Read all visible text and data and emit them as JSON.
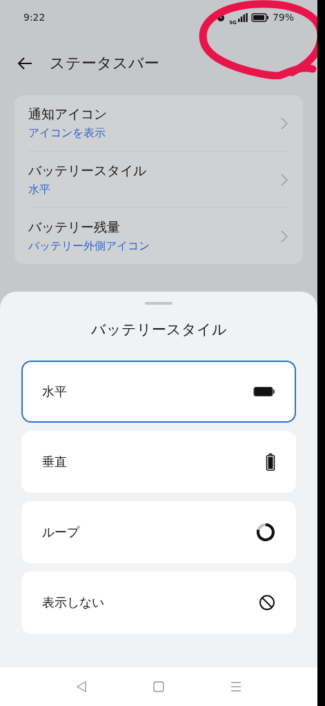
{
  "status_bar": {
    "time": "9:22",
    "network": "5G",
    "battery": "79%"
  },
  "header": {
    "title": "ステータスバー"
  },
  "settings": [
    {
      "label": "通知アイコン",
      "value": "アイコンを表示"
    },
    {
      "label": "バッテリースタイル",
      "value": "水平"
    },
    {
      "label": "バッテリー残量",
      "value": "バッテリー外側アイコン"
    }
  ],
  "sheet": {
    "title": "バッテリースタイル",
    "options": [
      {
        "label": "水平",
        "kind": "horizontal",
        "selected": true
      },
      {
        "label": "垂直",
        "kind": "vertical",
        "selected": false
      },
      {
        "label": "ループ",
        "kind": "loop",
        "selected": false
      },
      {
        "label": "表示しない",
        "kind": "hidden",
        "selected": false
      }
    ]
  }
}
